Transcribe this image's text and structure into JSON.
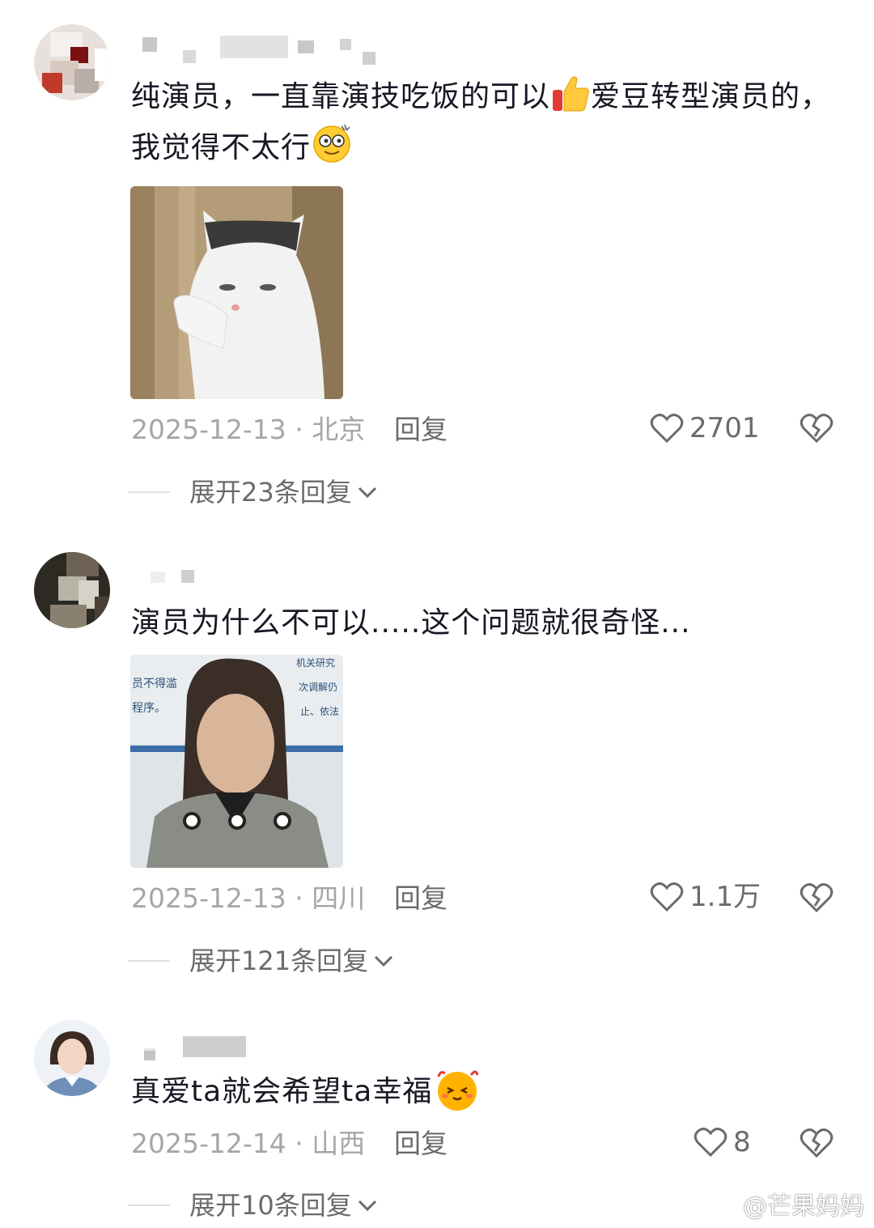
{
  "comments": [
    {
      "text_parts": [
        "纯演员，一直靠演技吃饭的可以",
        "爱豆转型演员的，",
        "我觉得不太行"
      ],
      "emojis": [
        "thumbs-up",
        "dizzy-face"
      ],
      "date": "2025-12-13",
      "separator": "·",
      "location": "北京",
      "reply_label": "回复",
      "likes": "2701",
      "expand_label": "展开23条回复",
      "image_name": "cat-meme-image"
    },
    {
      "text_parts": [
        "演员为什么不可以.....这个问题就很奇怪..."
      ],
      "emojis": [],
      "date": "2025-12-13",
      "separator": "·",
      "location": "四川",
      "reply_label": "回复",
      "likes": "1.1万",
      "expand_label": "展开121条回复",
      "image_name": "woman-meme-image"
    },
    {
      "text_parts": [
        "真爱ta就会希望ta幸福"
      ],
      "emojis": [
        "blushing-face"
      ],
      "date": "2025-12-14",
      "separator": "·",
      "location": "山西",
      "reply_label": "回复",
      "likes": "8",
      "expand_label": "展开10条回复",
      "image_name": ""
    }
  ],
  "watermark": "@芒果妈妈",
  "colors": {
    "text": "#161823",
    "meta": "#a6a6a6",
    "secondary": "#6b6b6b"
  }
}
